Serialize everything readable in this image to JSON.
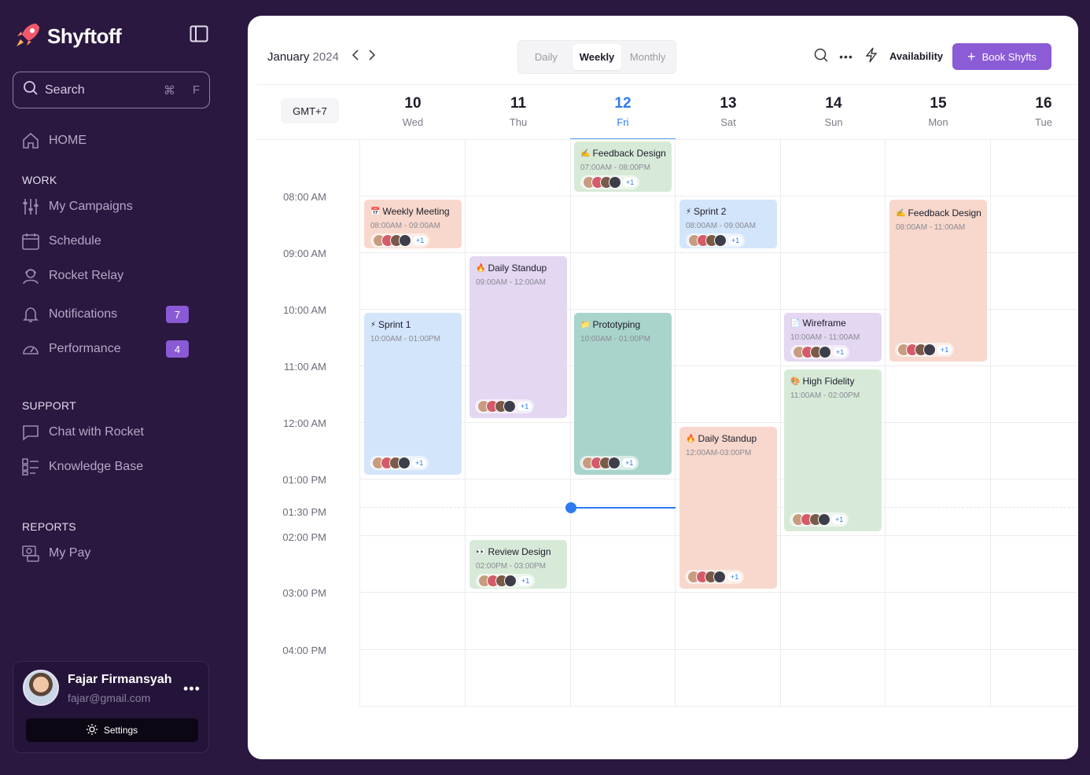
{
  "brand": {
    "name": "Shyftoff"
  },
  "search": {
    "placeholder": "Search",
    "shortcut_mod": "⌘",
    "shortcut_key": "F"
  },
  "nav": {
    "home": "HOME",
    "work_label": "WORK",
    "campaigns": "My Campaigns",
    "schedule": "Schedule",
    "relay": "Rocket Relay",
    "notifications": "Notifications",
    "notifications_count": "7",
    "performance": "Performance",
    "performance_count": "4",
    "support_label": "SUPPORT",
    "chat": "Chat with Rocket",
    "kb": "Knowledge Base",
    "reports_label": "REPORTS",
    "pay": "My Pay"
  },
  "profile": {
    "name": "Fajar Firmansyah",
    "email": "fajar@gmail.com",
    "settings": "Settings"
  },
  "toolbar": {
    "month": "January",
    "year": "2024",
    "views": [
      "Daily",
      "Weekly",
      "Monthly"
    ],
    "active_view": "Weekly",
    "availability": "Availability",
    "book": "Book Shyfts"
  },
  "timezone": "GMT+7",
  "days": [
    {
      "num": "10",
      "wd": "Wed"
    },
    {
      "num": "11",
      "wd": "Thu"
    },
    {
      "num": "12",
      "wd": "Fri",
      "today": true
    },
    {
      "num": "13",
      "wd": "Sat"
    },
    {
      "num": "14",
      "wd": "Sun"
    },
    {
      "num": "15",
      "wd": "Mon"
    },
    {
      "num": "16",
      "wd": "Tue"
    }
  ],
  "times": [
    "08:00 AM",
    "09:00 AM",
    "10:00 AM",
    "11:00 AM",
    "12:00 AM",
    "01:00 PM",
    "01:30 PM",
    "02:00 PM",
    "03:00 PM",
    "04:00 PM"
  ],
  "events": [
    {
      "title": "Feedback Design",
      "time": "07:00AM - 08:00PM",
      "extra": "+1",
      "emoji": "✍️"
    },
    {
      "title": "Weekly Meeting",
      "time": "08:00AM - 09:00AM",
      "extra": "+1",
      "emoji": "📅"
    },
    {
      "title": "Sprint 2",
      "time": "08:00AM - 09:00AM",
      "extra": "+1",
      "emoji": "⚡"
    },
    {
      "title": "Feedback Design",
      "time": "08:00AM - 11:00AM",
      "extra": "+1",
      "emoji": "✍️"
    },
    {
      "title": "Daily Standup",
      "time": "09:00AM - 12:00AM",
      "extra": "+1",
      "emoji": "🔥"
    },
    {
      "title": "Sprint 1",
      "time": "10:00AM - 01:00PM",
      "extra": "+1",
      "emoji": "⚡"
    },
    {
      "title": "Prototyping",
      "time": "10:00AM - 01:00PM",
      "extra": "+1",
      "emoji": "📁"
    },
    {
      "title": "Wireframe",
      "time": "10:00AM - 11:00AM",
      "extra": "+1",
      "emoji": "📄"
    },
    {
      "title": "High Fidelity",
      "time": "11:00AM - 02:00PM",
      "extra": "+1",
      "emoji": "🎨"
    },
    {
      "title": "Daily Standup",
      "time": "12:00AM-03:00PM",
      "extra": "+1",
      "emoji": "🔥"
    },
    {
      "title": "Review Design",
      "time": "02:00PM - 03:00PM",
      "extra": "+1",
      "emoji": "👀"
    }
  ],
  "colors": {
    "sidebar_bg": "#2a1840",
    "accent": "#8b5cd6",
    "today": "#2d7cf0"
  }
}
